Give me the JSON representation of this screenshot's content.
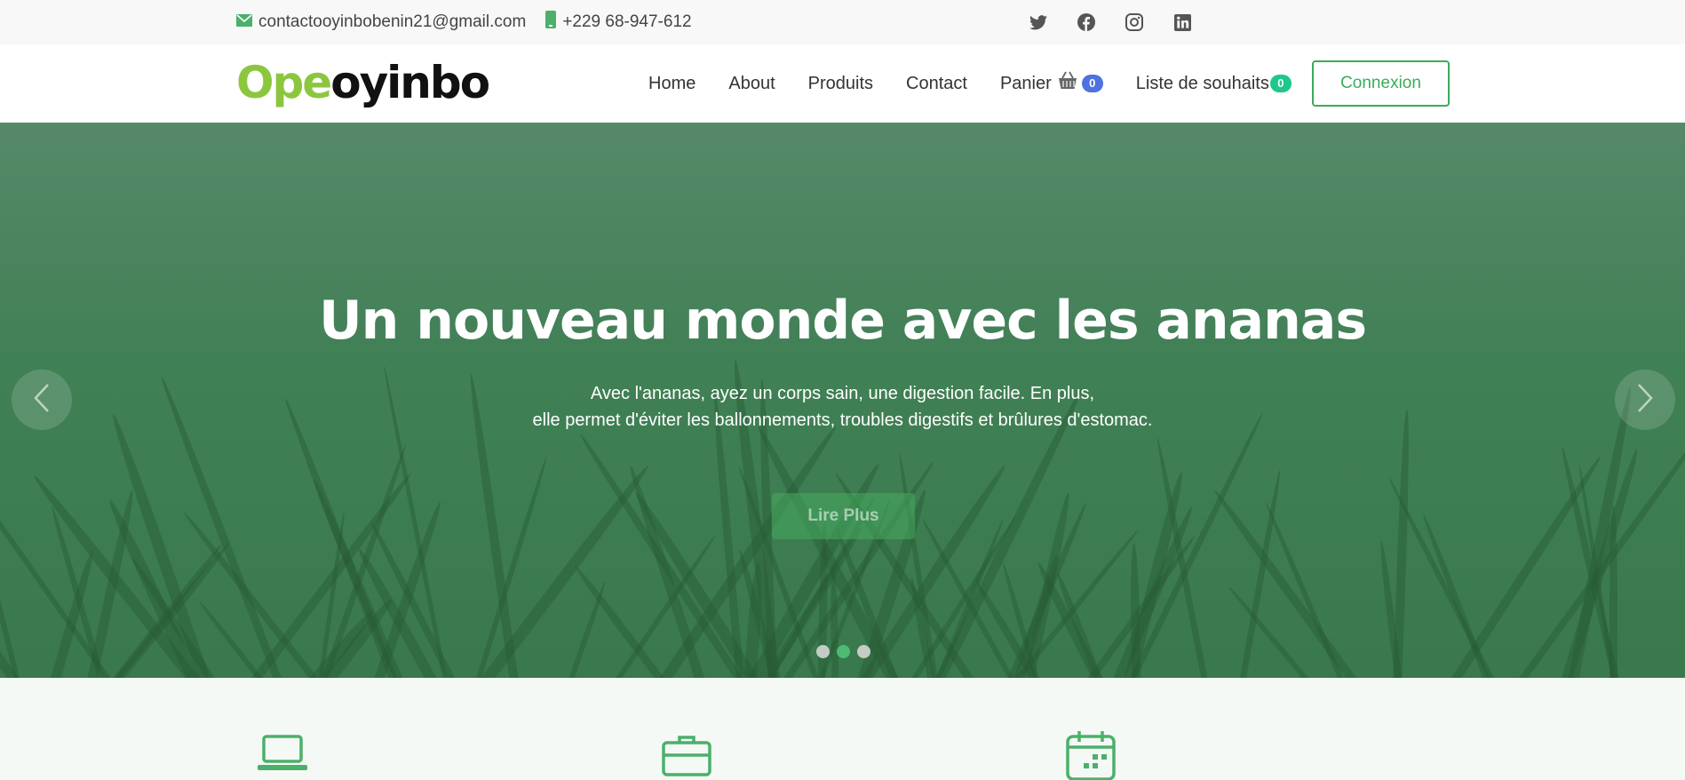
{
  "topbar": {
    "email": "contactooyinbobenin21@gmail.com",
    "phone": "+229 68-947-612",
    "social": [
      "twitter-icon",
      "facebook-icon",
      "instagram-icon",
      "linkedin-icon"
    ]
  },
  "nav": {
    "logo_part1": "Ope",
    "logo_part2": "oyinbo",
    "items": [
      {
        "label": "Home"
      },
      {
        "label": "About"
      },
      {
        "label": "Produits"
      },
      {
        "label": "Contact"
      }
    ],
    "cart_label": "Panier",
    "cart_count": "0",
    "wishlist_label": "Liste de souhaits",
    "wishlist_count": "0",
    "login_label": "Connexion"
  },
  "hero": {
    "title": "Un nouveau monde avec les ananas",
    "line1": "Avec l'ananas, ayez un corps sain, une digestion facile. En plus,",
    "line2": "elle permet d'éviter les ballonnements, troubles digestifs et brûlures d'estomac.",
    "cta": "Lire Plus",
    "slides": 3,
    "active_slide": 2
  },
  "features": {
    "icons": [
      "laptop-icon",
      "briefcase-icon",
      "calendar-icon"
    ]
  },
  "colors": {
    "accent": "#3bac5b",
    "logo_green": "#8cc63f",
    "badge_blue": "#4e73df",
    "badge_teal": "#1cc88a"
  }
}
